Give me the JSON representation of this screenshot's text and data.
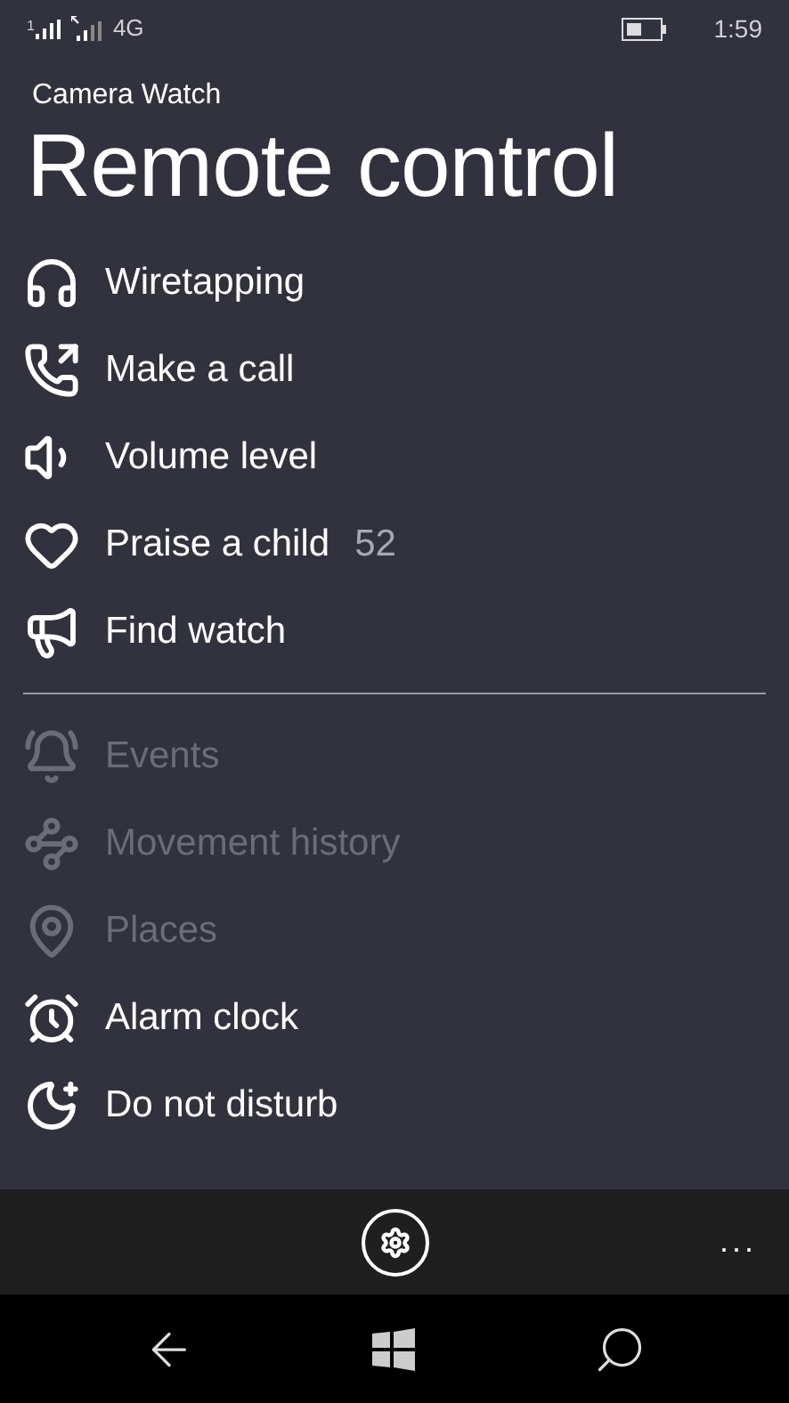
{
  "status_bar": {
    "sim_label": "1",
    "network": "4G",
    "time": "1:59"
  },
  "app_name": "Camera Watch",
  "page_title": "Remote control",
  "actions": [
    {
      "label": "Wiretapping",
      "disabled": false
    },
    {
      "label": "Make a call",
      "disabled": false
    },
    {
      "label": "Volume level",
      "disabled": false
    },
    {
      "label": "Praise a child",
      "count": "52",
      "disabled": false
    },
    {
      "label": "Find watch",
      "disabled": false
    }
  ],
  "features": [
    {
      "label": "Events",
      "disabled": true
    },
    {
      "label": "Movement history",
      "disabled": true
    },
    {
      "label": "Places",
      "disabled": true
    },
    {
      "label": "Alarm clock",
      "disabled": false
    },
    {
      "label": "Do not disturb",
      "disabled": false
    }
  ],
  "app_bar": {
    "more": "..."
  }
}
